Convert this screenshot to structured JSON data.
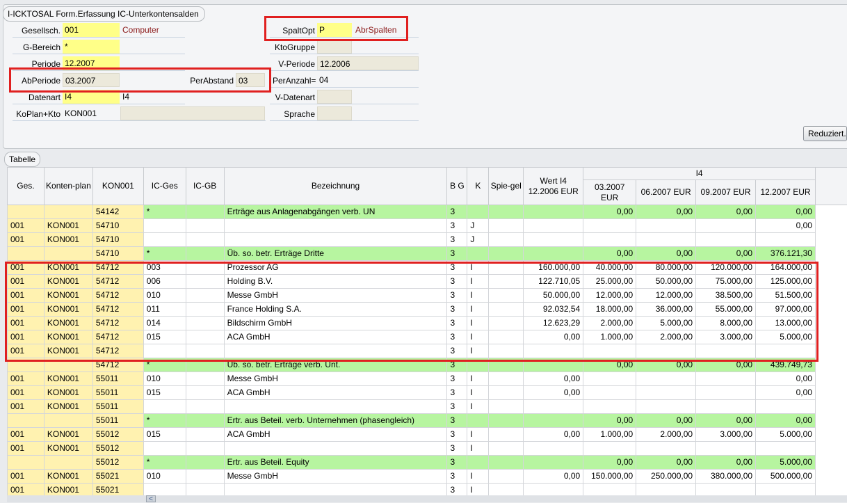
{
  "form": {
    "title": "I-ICKTOSAL Form.Erfassung IC-Unterkontensalden",
    "gesellsch": {
      "label": "Gesellsch.",
      "value": "001",
      "desc": "Computer"
    },
    "gbereich": {
      "label": "G-Bereich",
      "value": "*"
    },
    "periode": {
      "label": "Periode",
      "value": "12.2007"
    },
    "abperiode": {
      "label": "AbPeriode",
      "value": "03.2007"
    },
    "perabstand": {
      "label": "PerAbstand",
      "value": "03"
    },
    "datenart": {
      "label": "Datenart",
      "value": "I4",
      "desc": "I4"
    },
    "koplan": {
      "label": "KoPlan+Kto",
      "value": "KON001",
      "extra": ""
    },
    "spaltopt": {
      "label": "SpaltOpt",
      "value": "P",
      "desc": "AbrSpalten"
    },
    "ktogruppe": {
      "label": "KtoGruppe",
      "value": ""
    },
    "vperiode": {
      "label": "V-Periode",
      "value": "12.2006"
    },
    "peranzahl": {
      "label": "PerAnzahl=",
      "value": "04"
    },
    "vdatenart": {
      "label": "V-Datenart",
      "value": ""
    },
    "sprache": {
      "label": "Sprache",
      "value": ""
    },
    "reduziert_button": "Reduziert."
  },
  "table": {
    "tab_label": "Tabelle",
    "headers": {
      "ges": "Ges.",
      "kontenplan": "Konten-plan",
      "kon001": "KON001",
      "icges": "IC-Ges",
      "icgb": "IC-GB",
      "bezeichnung": "Bezeichnung",
      "bg": "B G",
      "k": "K",
      "spiegel": "Spie-gel",
      "wert": "Wert I4 12.2006 EUR",
      "group_i4": "I4",
      "p1": "03.2007 EUR",
      "p2": "06.2007 EUR",
      "p3": "09.2007 EUR",
      "p4": "12.2007 EUR"
    },
    "rows": [
      {
        "type": "sum",
        "ges": "",
        "plan": "",
        "konto": "54142",
        "icges": "*",
        "icgb": "",
        "bez": "Erträge aus Anlagenabgängen verb. UN",
        "bg": "3",
        "k": "",
        "spiegel": "",
        "wert": "",
        "p1": "0,00",
        "p2": "0,00",
        "p3": "0,00",
        "p4": "0,00"
      },
      {
        "type": "row",
        "ges": "001",
        "plan": "KON001",
        "konto": "54710",
        "icges": "",
        "icgb": "",
        "bez": "",
        "bg": "3",
        "k": "J",
        "spiegel": "",
        "wert": "",
        "p1": "",
        "p2": "",
        "p3": "",
        "p4": "0,00"
      },
      {
        "type": "row",
        "ges": "001",
        "plan": "KON001",
        "konto": "54710",
        "icges": "",
        "icgb": "",
        "bez": "",
        "bg": "3",
        "k": "J",
        "spiegel": "",
        "wert": "",
        "p1": "",
        "p2": "",
        "p3": "",
        "p4": ""
      },
      {
        "type": "sum",
        "ges": "",
        "plan": "",
        "konto": "54710",
        "icges": "*",
        "icgb": "",
        "bez": "Üb. so. betr. Erträge Dritte",
        "bg": "3",
        "k": "",
        "spiegel": "",
        "wert": "",
        "p1": "0,00",
        "p2": "0,00",
        "p3": "0,00",
        "p4": "376.121,30"
      },
      {
        "type": "row",
        "ges": "001",
        "plan": "KON001",
        "konto": "54712",
        "icges": "003",
        "icgb": "",
        "bez": "Prozessor AG",
        "bg": "3",
        "k": "I",
        "spiegel": "",
        "wert": "160.000,00",
        "p1": "40.000,00",
        "p2": "80.000,00",
        "p3": "120.000,00",
        "p4": "164.000,00"
      },
      {
        "type": "row",
        "ges": "001",
        "plan": "KON001",
        "konto": "54712",
        "icges": "006",
        "icgb": "",
        "bez": "Holding B.V.",
        "bg": "3",
        "k": "I",
        "spiegel": "",
        "wert": "122.710,05",
        "p1": "25.000,00",
        "p2": "50.000,00",
        "p3": "75.000,00",
        "p4": "125.000,00"
      },
      {
        "type": "row",
        "ges": "001",
        "plan": "KON001",
        "konto": "54712",
        "icges": "010",
        "icgb": "",
        "bez": "Messe GmbH",
        "bg": "3",
        "k": "I",
        "spiegel": "",
        "wert": "50.000,00",
        "p1": "12.000,00",
        "p2": "12.000,00",
        "p3": "38.500,00",
        "p4": "51.500,00"
      },
      {
        "type": "row",
        "ges": "001",
        "plan": "KON001",
        "konto": "54712",
        "icges": "011",
        "icgb": "",
        "bez": "France Holding S.A.",
        "bg": "3",
        "k": "I",
        "spiegel": "",
        "wert": "92.032,54",
        "p1": "18.000,00",
        "p2": "36.000,00",
        "p3": "55.000,00",
        "p4": "97.000,00"
      },
      {
        "type": "row",
        "ges": "001",
        "plan": "KON001",
        "konto": "54712",
        "icges": "014",
        "icgb": "",
        "bez": "Bildschirm GmbH",
        "bg": "3",
        "k": "I",
        "spiegel": "",
        "wert": "12.623,29",
        "p1": "2.000,00",
        "p2": "5.000,00",
        "p3": "8.000,00",
        "p4": "13.000,00"
      },
      {
        "type": "row",
        "ges": "001",
        "plan": "KON001",
        "konto": "54712",
        "icges": "015",
        "icgb": "",
        "bez": "ACA GmbH",
        "bg": "3",
        "k": "I",
        "spiegel": "",
        "wert": "0,00",
        "p1": "1.000,00",
        "p2": "2.000,00",
        "p3": "3.000,00",
        "p4": "5.000,00"
      },
      {
        "type": "row",
        "ges": "001",
        "plan": "KON001",
        "konto": "54712",
        "icges": "",
        "icgb": "",
        "bez": "",
        "bg": "3",
        "k": "I",
        "spiegel": "",
        "wert": "",
        "p1": "",
        "p2": "",
        "p3": "",
        "p4": ""
      },
      {
        "type": "sum",
        "ges": "",
        "plan": "",
        "konto": "54712",
        "icges": "*",
        "icgb": "",
        "bez": "Üb. so. betr. Erträge verb. Unt.",
        "bg": "3",
        "k": "",
        "spiegel": "",
        "wert": "",
        "p1": "0,00",
        "p2": "0,00",
        "p3": "0,00",
        "p4": "439.749,73"
      },
      {
        "type": "row",
        "ges": "001",
        "plan": "KON001",
        "konto": "55011",
        "icges": "010",
        "icgb": "",
        "bez": "Messe GmbH",
        "bg": "3",
        "k": "I",
        "spiegel": "",
        "wert": "0,00",
        "p1": "",
        "p2": "",
        "p3": "",
        "p4": "0,00"
      },
      {
        "type": "row",
        "ges": "001",
        "plan": "KON001",
        "konto": "55011",
        "icges": "015",
        "icgb": "",
        "bez": "ACA GmbH",
        "bg": "3",
        "k": "I",
        "spiegel": "",
        "wert": "0,00",
        "p1": "",
        "p2": "",
        "p3": "",
        "p4": "0,00"
      },
      {
        "type": "row",
        "ges": "001",
        "plan": "KON001",
        "konto": "55011",
        "icges": "",
        "icgb": "",
        "bez": "",
        "bg": "3",
        "k": "I",
        "spiegel": "",
        "wert": "",
        "p1": "",
        "p2": "",
        "p3": "",
        "p4": ""
      },
      {
        "type": "sum",
        "ges": "",
        "plan": "",
        "konto": "55011",
        "icges": "*",
        "icgb": "",
        "bez": "Ertr. aus Beteil. verb. Unternehmen (phasengleich)",
        "bg": "3",
        "k": "",
        "spiegel": "",
        "wert": "",
        "p1": "0,00",
        "p2": "0,00",
        "p3": "0,00",
        "p4": "0,00"
      },
      {
        "type": "row",
        "ges": "001",
        "plan": "KON001",
        "konto": "55012",
        "icges": "015",
        "icgb": "",
        "bez": "ACA GmbH",
        "bg": "3",
        "k": "I",
        "spiegel": "",
        "wert": "0,00",
        "p1": "1.000,00",
        "p2": "2.000,00",
        "p3": "3.000,00",
        "p4": "5.000,00"
      },
      {
        "type": "row",
        "ges": "001",
        "plan": "KON001",
        "konto": "55012",
        "icges": "",
        "icgb": "",
        "bez": "",
        "bg": "3",
        "k": "I",
        "spiegel": "",
        "wert": "",
        "p1": "",
        "p2": "",
        "p3": "",
        "p4": ""
      },
      {
        "type": "sum",
        "ges": "",
        "plan": "",
        "konto": "55012",
        "icges": "*",
        "icgb": "",
        "bez": "Ertr. aus Beteil. Equity",
        "bg": "3",
        "k": "",
        "spiegel": "",
        "wert": "",
        "p1": "0,00",
        "p2": "0,00",
        "p3": "0,00",
        "p4": "5.000,00"
      },
      {
        "type": "row",
        "ges": "001",
        "plan": "KON001",
        "konto": "55021",
        "icges": "010",
        "icgb": "",
        "bez": "Messe GmbH",
        "bg": "3",
        "k": "I",
        "spiegel": "",
        "wert": "0,00",
        "p1": "150.000,00",
        "p2": "250.000,00",
        "p3": "380.000,00",
        "p4": "500.000,00"
      },
      {
        "type": "row",
        "ges": "001",
        "plan": "KON001",
        "konto": "55021",
        "icges": "",
        "icgb": "",
        "bez": "",
        "bg": "3",
        "k": "I",
        "spiegel": "",
        "wert": "",
        "p1": "",
        "p2": "",
        "p3": "",
        "p4": ""
      }
    ]
  },
  "scrollbar": {
    "left_arrow": "<"
  }
}
